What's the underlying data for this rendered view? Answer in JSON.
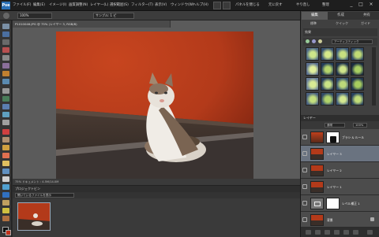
{
  "menubar": {
    "app_icon": "Pse",
    "items": [
      "ファイル(F)",
      "編集(E)",
      "イメージ(I)",
      "画質調整(N)",
      "レイヤー(L)",
      "選択範囲(S)",
      "フィルター(T)",
      "表示(V)",
      "ウィンドウ(W)",
      "ヘルプ(H)"
    ],
    "commands": [
      "パネルを閉じる",
      "元に戻す",
      "やり直し",
      "整理"
    ],
    "window_controls": [
      "_",
      "□",
      "×"
    ]
  },
  "options": {
    "zoom_value": "100%",
    "dropdown_label": "サンプル: 1 ピ"
  },
  "document": {
    "tab_title": "P1010046.JPG @ 75% (レイヤー 3, RGB/8)",
    "status_text": "75%   ドキュメント : 4.5M/14.0M"
  },
  "project_bin": {
    "title": "プロジェクトビン",
    "dropdown": "開いているファイルを表示"
  },
  "right_panel": {
    "tabs": [
      "編集",
      "作成",
      "共有"
    ],
    "subtabs": [
      "標準",
      "クイック",
      "ガイド"
    ],
    "effects_label": "効果",
    "filter_dropdown": "アーティスティック",
    "layers_title": "レイヤー",
    "blend_mode": "通常",
    "opacity": "100%",
    "layers": [
      {
        "name": "ブラシ & ルール",
        "selected": false,
        "mask": true
      },
      {
        "name": "レイヤー 3",
        "selected": true,
        "mask": false
      },
      {
        "name": "レイヤー 2",
        "selected": false,
        "mask": false
      },
      {
        "name": "レイヤー 1",
        "selected": false,
        "mask": false
      },
      {
        "name": "レベル補正 1",
        "selected": false,
        "mask": true
      },
      {
        "name": "背景",
        "selected": false,
        "mask": false
      }
    ]
  },
  "colors": {
    "wall": "#b33a1a",
    "accent": "#2a6fb5",
    "selected_layer": "#6a7380"
  }
}
